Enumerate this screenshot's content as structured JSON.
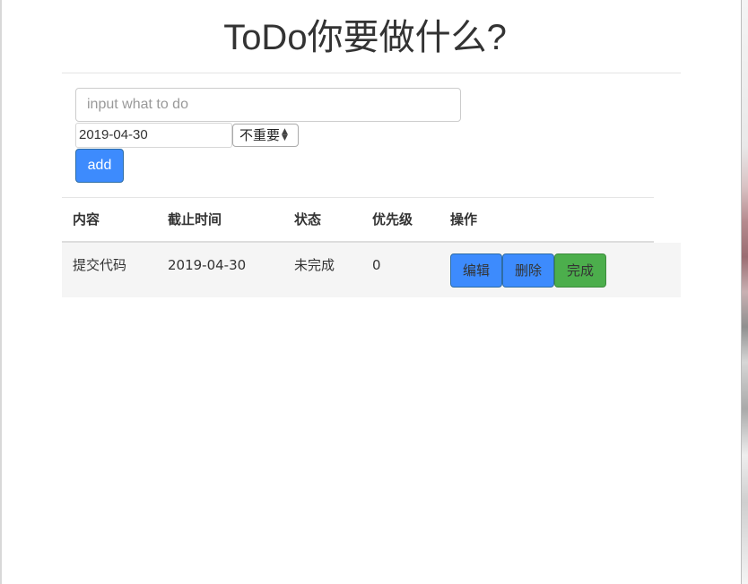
{
  "header": {
    "title": "ToDo你要做什么?"
  },
  "form": {
    "todo_input": {
      "placeholder": "input what to do",
      "value": ""
    },
    "date_input": {
      "value": "2019-04-30"
    },
    "priority_select": {
      "selected": "不重要"
    },
    "add_button_label": "add"
  },
  "table": {
    "headers": [
      "内容",
      "截止时间",
      "状态",
      "优先级",
      "操作"
    ],
    "rows": [
      {
        "content": "提交代码",
        "deadline": "2019-04-30",
        "status": "未完成",
        "priority": "0",
        "actions": [
          "编辑",
          "删除",
          "完成"
        ]
      }
    ]
  },
  "colors": {
    "primary_button": "#3d8bfd",
    "success_button": "#4cae4c",
    "row_background": "#f5f5f5"
  }
}
